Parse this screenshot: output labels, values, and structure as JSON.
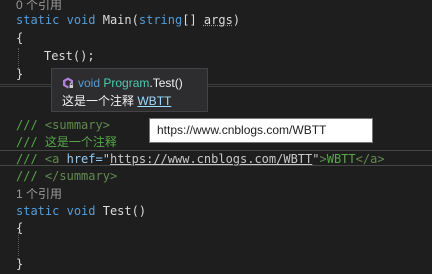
{
  "colors": {
    "background": "#1e1e1e",
    "keyword": "#569cd6",
    "comment": "#57a64a",
    "tooltip_bg": "#2d2d30",
    "link": "#9cdcfe",
    "type": "#4ec9b0"
  },
  "code": {
    "codelens_main": "0 个引用",
    "main_kw1": "static",
    "main_kw2": "void",
    "main_name": "Main",
    "main_paren_open": "(",
    "main_param_type": "string",
    "main_brackets": "[] ",
    "main_param_name": "args",
    "main_paren_close": ")",
    "brace_open": "{",
    "call_stmt": "Test();",
    "brace_close": "}",
    "doc_slashes": "///",
    "doc_summary_open": "<summary>",
    "doc_text": "这是一个注释",
    "doc_a_open": "<a",
    "doc_href_attr": "href=",
    "doc_quote": "\"",
    "doc_url": "https://www.cnblogs.com/WBTT",
    "doc_tag_end": ">",
    "doc_link_text": "WBTT",
    "doc_a_close": "</a>",
    "doc_summary_close": "</summary>",
    "codelens_test": "1 个引用",
    "test_kw1": "static",
    "test_kw2": "void",
    "test_name": "Test",
    "test_parens": "()"
  },
  "quickinfo": {
    "icon": "method-icon",
    "keyword": "void",
    "type": "Program",
    "dot": ".",
    "method": "Test()",
    "description": "这是一个注释",
    "link_text": "WBTT"
  },
  "url_tooltip": {
    "text": "https://www.cnblogs.com/WBTT"
  }
}
